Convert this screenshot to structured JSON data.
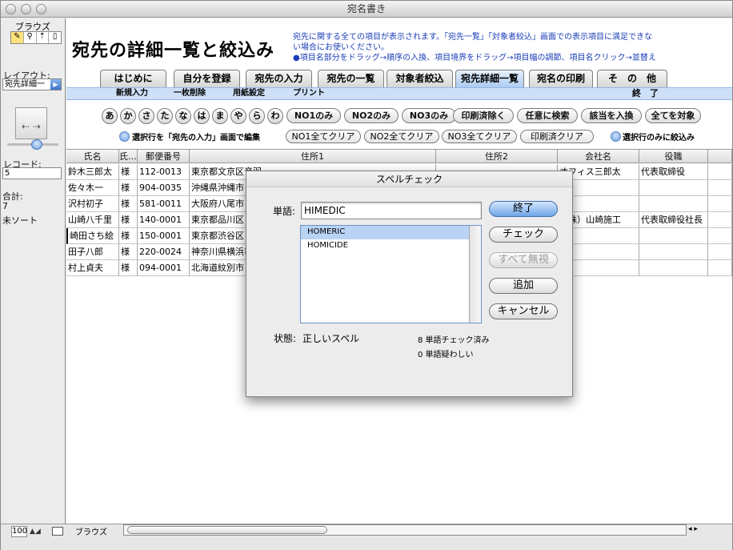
{
  "window": {
    "title": "宛名書き"
  },
  "sidebar": {
    "mode_label": "ブラウズ",
    "layout_label": "レイアウト:",
    "layout_value": "宛先詳細一",
    "record_label": "レコード:",
    "record_value": "5",
    "total_label": "合計:",
    "total_value": "7",
    "sort_status": "未ソート"
  },
  "header": {
    "title": "宛先の詳細一覧と絞込み",
    "description_line1": "宛先に関する全ての項目が表示されます。「宛先一覧」「対象者絞込」画面での表示項目に満足できな",
    "description_line2": "い場合にお使いください。",
    "description_line3": "●項目名部分をドラッグ→順序の入換、項目境界をドラッグ→項目幅の調節、項目名クリック→並替え"
  },
  "tabs": [
    "はじめに",
    "自分を登録",
    "宛先の入力",
    "宛先の一覧",
    "対象者絞込",
    "宛先詳細一覧",
    "宛名の印刷",
    "そ　の　他"
  ],
  "subtoolbar": {
    "items": [
      "新規入力",
      "一枚削除",
      "用紙設定",
      "プリント"
    ],
    "end_label": "終　了"
  },
  "kana_buttons": [
    "あ",
    "か",
    "さ",
    "た",
    "な",
    "は",
    "ま",
    "や",
    "ら",
    "わ"
  ],
  "filter_buttons": [
    "NO1のみ",
    "NO2のみ",
    "NO3のみ",
    "印刷済除く",
    "任意に検索",
    "該当を入換",
    "全てを対象"
  ],
  "row2": {
    "edit_label": "選択行を「宛先の入力」画面で編集",
    "buttons": [
      "NO1全てクリア",
      "NO2全てクリア",
      "NO3全てクリア",
      "印刷済クリア"
    ],
    "narrow_label": "選択行のみに絞込み"
  },
  "table": {
    "columns": [
      "氏名",
      "氏…",
      "郵便番号",
      "住所1",
      "住所2",
      "会社名",
      "役職"
    ],
    "rows": [
      [
        "鈴木三郎太",
        "様",
        "112-0013",
        "東京都文京区音羽",
        "",
        "オフィス三郎太",
        "代表取締役"
      ],
      [
        "佐々木一",
        "様",
        "904-0035",
        "沖縄県沖縄市",
        "",
        "",
        ""
      ],
      [
        "沢村初子",
        "様",
        "581-0011",
        "大阪府八尾市",
        "",
        "",
        ""
      ],
      [
        "山崎八千里",
        "様",
        "140-0001",
        "東京都品川区",
        "",
        "（株）山崎施工",
        "代表取締役社長"
      ],
      [
        "崎田さち絵",
        "様",
        "150-0001",
        "東京都渋谷区",
        "",
        "",
        ""
      ],
      [
        "田子八郎",
        "様",
        "220-0024",
        "神奈川県横浜市",
        "",
        "",
        ""
      ],
      [
        "村上貞夫",
        "様",
        "094-0001",
        "北海道紋別市",
        "",
        "",
        ""
      ]
    ]
  },
  "dialog": {
    "title": "スペルチェック",
    "word_label": "単語:",
    "word_value": "HIMEDIC",
    "suggestions": [
      "HOMERIC",
      "HOMICIDE"
    ],
    "buttons": {
      "done": "終了",
      "check": "チェック",
      "ignore_all": "すべて無視",
      "add": "追加",
      "cancel": "キャンセル"
    },
    "status_label": "状態:",
    "status_value": "正しいスペル",
    "words_checked": "8 単語チェック済み",
    "words_questionable": "0 単語疑わしい"
  },
  "bottom": {
    "zoom": "100",
    "mode": "ブラウズ"
  }
}
